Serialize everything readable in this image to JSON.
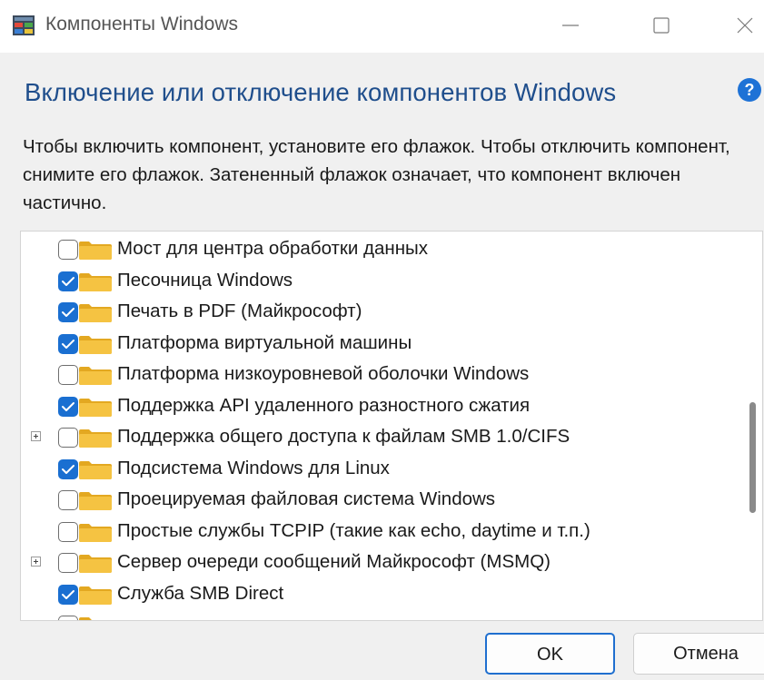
{
  "window": {
    "title": "Компоненты Windows",
    "controls": {
      "minimize": "minimize",
      "maximize": "maximize",
      "close": "close"
    }
  },
  "header": {
    "heading": "Включение или отключение компонентов Windows",
    "help_icon_text": "?",
    "description": "Чтобы включить компонент, установите его флажок. Чтобы отключить компонент, снимите его флажок. Затененный флажок означает, что компонент включен частично."
  },
  "features": [
    {
      "label": "Мост для центра обработки данных",
      "checked": false,
      "expandable": false
    },
    {
      "label": "Песочница Windows",
      "checked": true,
      "expandable": false
    },
    {
      "label": "Печать в PDF (Майкрософт)",
      "checked": true,
      "expandable": false
    },
    {
      "label": "Платформа виртуальной машины",
      "checked": true,
      "expandable": false
    },
    {
      "label": "Платформа низкоуровневой оболочки Windows",
      "checked": false,
      "expandable": false
    },
    {
      "label": "Поддержка API удаленного разностного сжатия",
      "checked": true,
      "expandable": false
    },
    {
      "label": "Поддержка общего доступа к файлам SMB 1.0/CIFS",
      "checked": false,
      "expandable": true
    },
    {
      "label": "Подсистема Windows для Linux",
      "checked": true,
      "expandable": false
    },
    {
      "label": "Проецируемая файловая система Windows",
      "checked": false,
      "expandable": false
    },
    {
      "label": "Простые службы TCPIP (такие как echo, daytime и т.п.)",
      "checked": false,
      "expandable": false
    },
    {
      "label": "Сервер очереди сообщений Майкрософт (MSMQ)",
      "checked": false,
      "expandable": true
    },
    {
      "label": "Служба SMB Direct",
      "checked": true,
      "expandable": false
    }
  ],
  "buttons": {
    "ok": "OK",
    "cancel": "Отмена"
  },
  "colors": {
    "accent": "#1a6fd1",
    "heading": "#1f4e8c",
    "folder": "#f5c342"
  }
}
